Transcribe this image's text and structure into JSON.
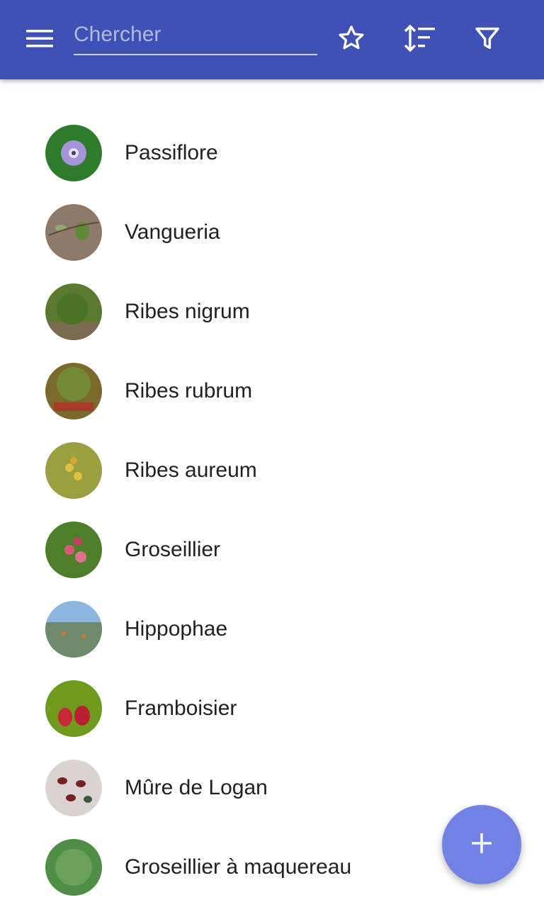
{
  "app_bar": {
    "background": "#3f51b5",
    "menu_icon": "hamburger-menu-icon",
    "search_placeholder": "Chercher",
    "favorites_icon": "star-outline-icon",
    "sort_icon": "sort-icon",
    "filter_icon": "filter-icon"
  },
  "plants": [
    {
      "name": "Passiflore",
      "thumb_color": "#2f7d2a"
    },
    {
      "name": "Vangueria",
      "thumb_color": "#8d7a6a"
    },
    {
      "name": "Ribes nigrum",
      "thumb_color": "#5b7a2e"
    },
    {
      "name": "Ribes rubrum",
      "thumb_color": "#7a6a2c"
    },
    {
      "name": "Ribes aureum",
      "thumb_color": "#9aa040"
    },
    {
      "name": "Groseillier",
      "thumb_color": "#4d7f2a"
    },
    {
      "name": "Hippophae",
      "thumb_color": "#6f8a6c"
    },
    {
      "name": "Framboisier",
      "thumb_color": "#6f9a1c"
    },
    {
      "name": "Mûre de Logan",
      "thumb_color": "#d9d2d0"
    },
    {
      "name": "Groseillier à maquereau",
      "thumb_color": "#4f8f45"
    }
  ],
  "fab": {
    "icon": "plus-icon",
    "color": "#7281e4"
  }
}
